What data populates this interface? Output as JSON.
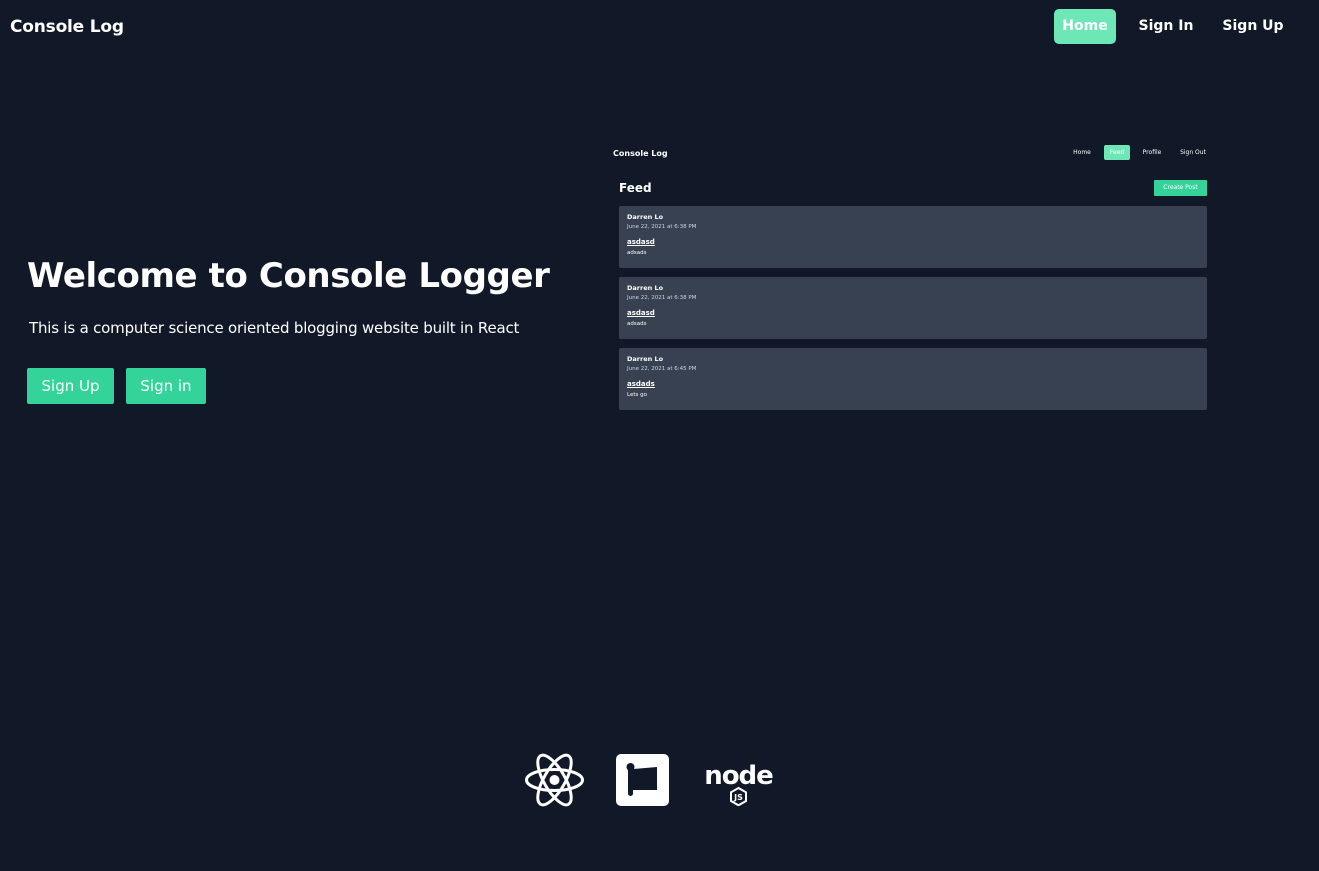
{
  "navbar": {
    "brand": "Console Log",
    "links": [
      {
        "label": "Home",
        "active": true
      },
      {
        "label": "Sign In"
      },
      {
        "label": "Sign Up"
      }
    ]
  },
  "hero": {
    "title": "Welcome to Console Logger",
    "subtitle": "This is a computer science oriented blogging website built in React",
    "buttons": [
      {
        "label": "Sign Up"
      },
      {
        "label": "Sign in"
      }
    ]
  },
  "preview": {
    "brand": "Console Log",
    "nav": [
      {
        "label": "Home"
      },
      {
        "label": "Feed",
        "active": true
      },
      {
        "label": "Profile"
      },
      {
        "label": "Sign Out"
      }
    ],
    "title": "Feed",
    "create_button": "Create Post",
    "posts": [
      {
        "author": "Darren Lo",
        "date": "June 22, 2021 at 6:38 PM",
        "title": "asdasd",
        "body": "adsads"
      },
      {
        "author": "Darren Lo",
        "date": "June 22, 2021 at 6:38 PM",
        "title": "asdasd",
        "body": "adsads"
      },
      {
        "author": "Darren Lo",
        "date": "June 22, 2021 at 6:45 PM",
        "title": "asdads",
        "body": "Lets go"
      }
    ]
  },
  "footer": {
    "logos": [
      {
        "icon": "react-icon"
      },
      {
        "icon": "firebase-icon"
      },
      {
        "icon": "nodejs-icon",
        "text": "node",
        "badge": "JS"
      }
    ]
  },
  "colors": {
    "background": "#111827",
    "accent": "#34d399",
    "accent_light": "#6ee7b7",
    "card": "#374151"
  }
}
